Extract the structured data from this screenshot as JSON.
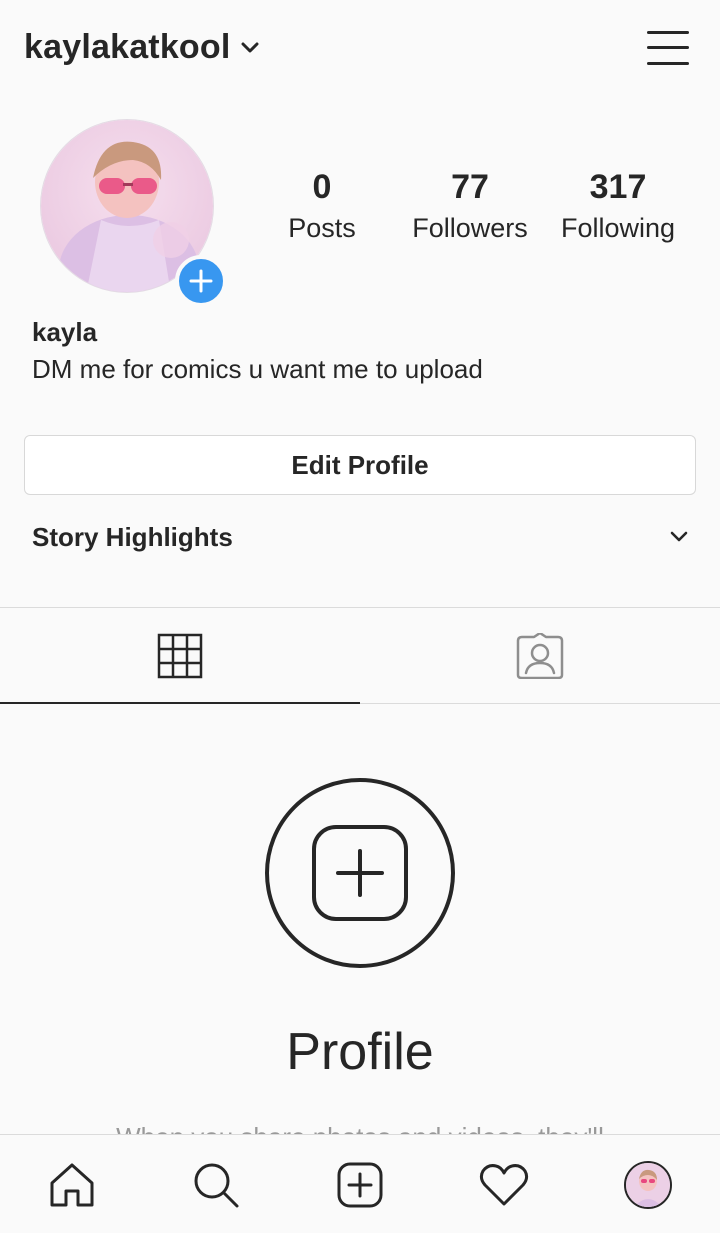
{
  "header": {
    "username": "kaylakatkool",
    "username_dropdown_icon": "chevron-down-icon",
    "menu_icon": "hamburger-menu-icon"
  },
  "profile": {
    "avatar_icon": "profile-photo",
    "add_story_icon": "plus-icon",
    "stats": {
      "posts": {
        "value": "0",
        "label": "Posts"
      },
      "followers": {
        "value": "77",
        "label": "Followers"
      },
      "following": {
        "value": "317",
        "label": "Following"
      }
    },
    "name": "kayla",
    "bio": "DM me for comics u want me to upload"
  },
  "actions": {
    "edit_profile_label": "Edit Profile"
  },
  "highlights": {
    "title": "Story Highlights",
    "toggle_icon": "chevron-down-icon"
  },
  "tabs": [
    {
      "icon": "grid-icon",
      "active": true
    },
    {
      "icon": "tagged-photos-icon",
      "active": false
    }
  ],
  "empty_state": {
    "icon": "add-post-icon",
    "title": "Profile",
    "subtitle": "When you share photos and videos, they'll"
  },
  "bottom_nav": [
    {
      "icon": "home-icon"
    },
    {
      "icon": "search-icon"
    },
    {
      "icon": "new-post-icon"
    },
    {
      "icon": "heart-icon"
    },
    {
      "icon": "profile-avatar-icon"
    }
  ],
  "colors": {
    "accent": "#3897f0",
    "text": "#262626",
    "background": "#fafafa",
    "border": "#dbdbdb"
  }
}
